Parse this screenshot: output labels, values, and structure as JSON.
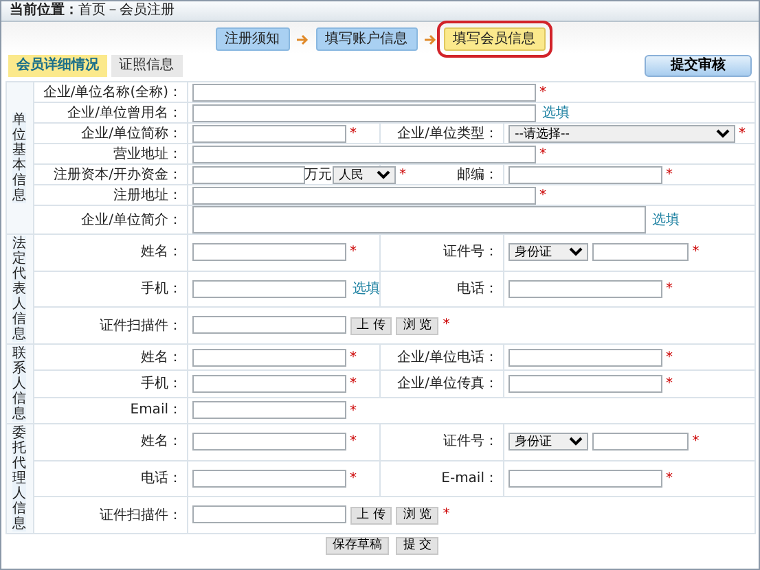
{
  "breadcrumb": "**当前位置：**首页－会员注册",
  "steps": [
    {
      "label": "注册须知",
      "selected": false
    },
    {
      "label": "填写账户信息",
      "selected": false
    },
    {
      "label": "填写会员信息",
      "selected": true
    }
  ],
  "tabs": [
    {
      "label": "会员详细情况",
      "selected": true
    },
    {
      "label": "证照信息",
      "selected": false
    }
  ],
  "submit_review_button": "提交审核",
  "sections": [
    {
      "title": "单位基本信息",
      "rows": [
        {
          "fields": [
            {
              "label": "企业/单位名称(全称)：",
              "kind": "text",
              "mark": "*"
            }
          ]
        },
        {
          "fields": [
            {
              "label": "企业/单位曾用名：",
              "kind": "text",
              "note": "选填"
            }
          ]
        },
        {
          "fields": [
            {
              "label": "企业/单位简称：",
              "kind": "text",
              "mark": "*"
            },
            {
              "label": "企业/单位类型：",
              "kind": "select",
              "value": "--请选择--",
              "mark": "*"
            }
          ]
        },
        {
          "fields": [
            {
              "label": "营业地址：",
              "kind": "text",
              "mark": "*"
            }
          ]
        },
        {
          "fields": [
            {
              "label": "注册资本/开办资金：",
              "kind": "money",
              "unit": "万元",
              "value": "人民",
              "mark": "*"
            },
            {
              "label": "邮编：",
              "kind": "text",
              "mark": "*"
            }
          ]
        },
        {
          "fields": [
            {
              "label": "注册地址：",
              "kind": "text",
              "mark": "*"
            }
          ]
        },
        {
          "fields": [
            {
              "label": "企业/单位简介：",
              "kind": "textarea",
              "note": "选填"
            }
          ]
        }
      ]
    },
    {
      "title": "法定代表人信息",
      "rows": [
        {
          "fields": [
            {
              "label": "姓名：",
              "kind": "text",
              "mark": "*"
            },
            {
              "label": "证件号：",
              "kind": "id",
              "value": "身份证",
              "mark": "*"
            }
          ]
        },
        {
          "fields": [
            {
              "label": "手机：",
              "kind": "text",
              "note": "选填"
            },
            {
              "label": "电话：",
              "kind": "text",
              "mark": "*"
            }
          ]
        },
        {
          "fields": [
            {
              "label": "证件扫描件：",
              "kind": "upload",
              "buttons": [
                "上 传",
                "浏 览"
              ],
              "mark": "*"
            }
          ]
        }
      ]
    },
    {
      "title": "联系人信息",
      "rows": [
        {
          "fields": [
            {
              "label": "姓名：",
              "kind": "text",
              "mark": "*"
            },
            {
              "label": "企业/单位电话：",
              "kind": "text",
              "mark": "*"
            }
          ]
        },
        {
          "fields": [
            {
              "label": "手机：",
              "kind": "text",
              "mark": "*"
            },
            {
              "label": "企业/单位传真：",
              "kind": "text",
              "mark": "*"
            }
          ]
        },
        {
          "fields": [
            {
              "label": "Email：",
              "kind": "short",
              "mark": "*"
            }
          ]
        }
      ]
    },
    {
      "title": "委托代理人信息",
      "rows": [
        {
          "fields": [
            {
              "label": "姓名：",
              "kind": "text",
              "mark": "*"
            },
            {
              "label": "证件号：",
              "kind": "id",
              "value": "身份证",
              "mark": "*"
            }
          ]
        },
        {
          "fields": [
            {
              "label": "电话：",
              "kind": "text",
              "mark": "*"
            },
            {
              "label": "E-mail：",
              "kind": "text",
              "mark": "*"
            }
          ]
        },
        {
          "fields": [
            {
              "label": "证件扫描件：",
              "kind": "upload",
              "buttons": [
                "上 传",
                "浏 览"
              ],
              "mark": "*"
            }
          ]
        }
      ]
    }
  ],
  "form_buttons": [
    "保存草稿",
    "提 交"
  ]
}
